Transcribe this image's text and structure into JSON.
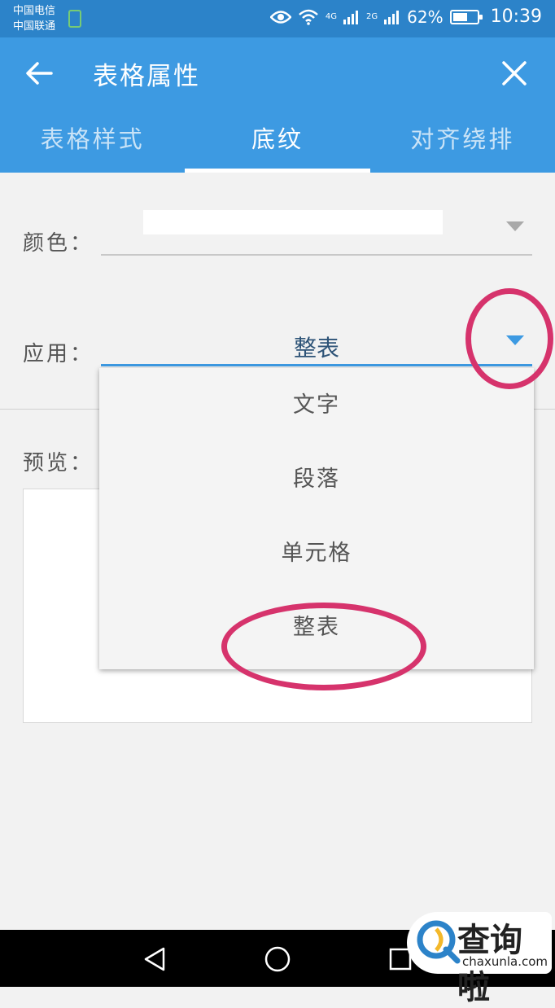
{
  "status_bar": {
    "carrier_1": "中国电信",
    "carrier_2": "中国联通",
    "network_1": "4G",
    "network_2": "2G",
    "battery": "62%",
    "battery_level": 0.62,
    "time": "10:39",
    "icons": [
      "eye-icon",
      "wifi-icon",
      "signal-icon",
      "battery-icon"
    ]
  },
  "app_bar": {
    "title": "表格属性",
    "back_icon": "arrow-left-icon",
    "close_icon": "close-icon"
  },
  "tabs": [
    {
      "label": "表格样式",
      "active": false
    },
    {
      "label": "底纹",
      "active": true
    },
    {
      "label": "对齐绕排",
      "active": false
    }
  ],
  "form": {
    "color_label": "颜色：",
    "apply_label": "应用：",
    "apply_value": "整表",
    "preview_label": "预览："
  },
  "dropdown": {
    "options": [
      "文字",
      "段落",
      "单元格",
      "整表"
    ]
  },
  "watermark": {
    "text": "查询啦",
    "url": "chaxunla.com"
  },
  "colors": {
    "accent": "#3d9ae2",
    "status_bar": "#2c83c9",
    "annotation": "#d6336c"
  }
}
